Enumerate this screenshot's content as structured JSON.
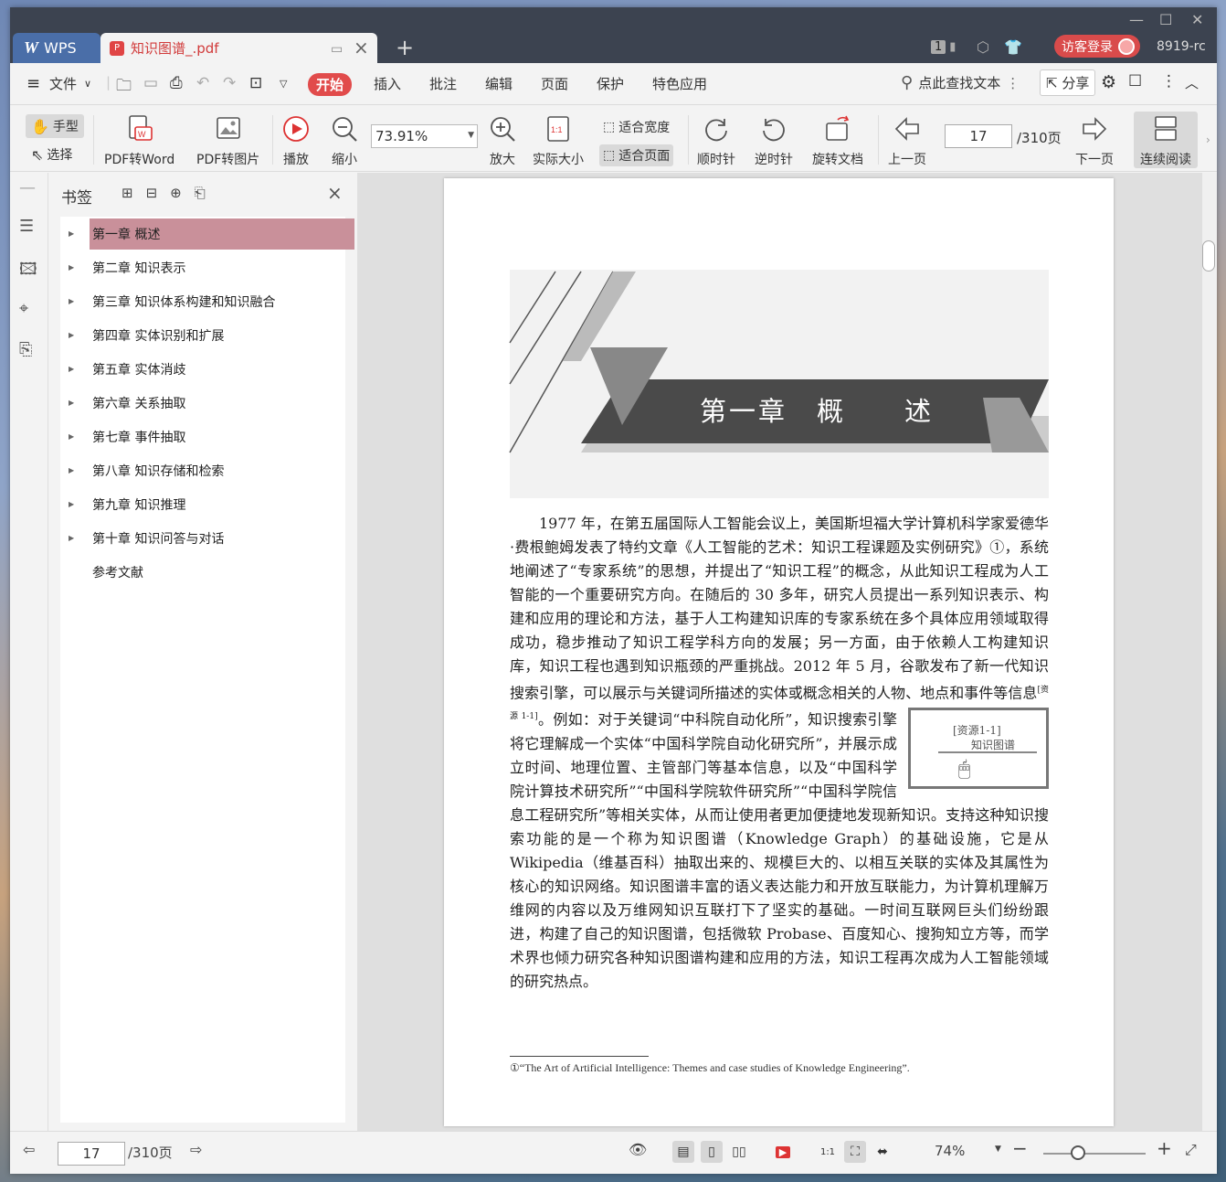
{
  "titlebar": {
    "app_tab": "WPS",
    "doc_tab": "知识图谱_.pdf",
    "page_badge": "1",
    "login": "访客登录",
    "user": "8919-rc"
  },
  "menu": {
    "file": "文件",
    "items": [
      "开始",
      "插入",
      "批注",
      "编辑",
      "页面",
      "保护",
      "特色应用"
    ],
    "search": "点此查找文本",
    "share": "分享"
  },
  "ribbon": {
    "hand": "手型",
    "select": "选择",
    "pdf_to_word": "PDF转Word",
    "pdf_to_image": "PDF转图片",
    "play": "播放",
    "zoom_out": "缩小",
    "zoom_value": "73.91%",
    "zoom_in": "放大",
    "actual_size": "实际大小",
    "fit_width": "适合宽度",
    "fit_page": "适合页面",
    "clockwise": "顺时针",
    "counterclockwise": "逆时针",
    "rotate_doc": "旋转文档",
    "prev_page": "上一页",
    "page_current": "17",
    "page_total": "/310页",
    "next_page": "下一页",
    "continuous": "连续阅读"
  },
  "bookmarks": {
    "title": "书签",
    "items": [
      {
        "label": "第一章 概述",
        "selected": true,
        "expandable": true
      },
      {
        "label": "第二章 知识表示",
        "expandable": true
      },
      {
        "label": "第三章 知识体系构建和知识融合",
        "expandable": true
      },
      {
        "label": "第四章 实体识别和扩展",
        "expandable": true
      },
      {
        "label": "第五章 实体消歧",
        "expandable": true
      },
      {
        "label": "第六章 关系抽取",
        "expandable": true
      },
      {
        "label": "第七章 事件抽取",
        "expandable": true
      },
      {
        "label": "第八章 知识存储和检索",
        "expandable": true
      },
      {
        "label": "第九章 知识推理",
        "expandable": true
      },
      {
        "label": "第十章 知识问答与对话",
        "expandable": true
      },
      {
        "label": "参考文献",
        "expandable": false
      }
    ]
  },
  "document": {
    "chapter_title": "第一章　概　　述",
    "para_before_box": "1977 年，在第五届国际人工智能会议上，美国斯坦福大学计算机科学家爱德华·费根鲍姆发表了特约文章《人工智能的艺术：知识工程课题及实例研究》①，系统地阐述了“专家系统”的思想，并提出了“知识工程”的概念，从此知识工程成为人工智能的一个重要研究方向。在随后的 30 多年，研究人员提出一系列知识表示、构建和应用的理论和方法，基于人工构建知识库的专家系统在多个具体应用领域取得成功，稳步推动了知识工程学科方向的发展；另一方面，由于依赖人工构建知识库，知识工程也遇到知识瓶颈的严重挑战。2012 年 5 月，谷歌发布了新一代知识搜索引擎，可以展示与关键词所描述的实体或概念相关的人物、地点和事件等信息",
    "resource_ref": "[资源 1-1]",
    "para_after_box": "。例如：对于关键词“中科院自动化所”，知识搜索引擎将它理解成一个实体“中国科学院自动化研究所”，并展示成立时间、地理位置、主管部门等基本信息，以及“中国科学院计算技术研究所”“中国科学院软件研究所”“中国科学院信息工程研究所”等相关实体，从而让使用者更加便捷地发现新知识。支持这种知识搜索功能的是一个称为知识图谱（Knowledge Graph）的基础设施，它是从 Wikipedia（维基百科）抽取出来的、规模巨大的、以相互关联的实体及其属性为核心的知识网络。知识图谱丰富的语义表达能力和开放互联能力，为计算机理解万维网的内容以及万维网知识互联打下了坚实的基础。一时间互联网巨头们纷纷跟进，构建了自己的知识图谱，包括微软 Probase、百度知心、搜狗知立方等，而学术界也倾力研究各种知识图谱构建和应用的方法，知识工程再次成为人工智能领域的研究热点。",
    "resource_box_line1": "[资源1-1]",
    "resource_box_line2": "知识图谱",
    "footnote": "①“The Art of Artificial Intelligence: Themes and case studies of Knowledge Engineering”."
  },
  "status": {
    "page_current": "17",
    "page_total": "/310页",
    "zoom": "74%"
  },
  "colors": {
    "accent_red": "#e14b4b",
    "selected_bookmark": "#c9909a",
    "titlebar": "#3c4350"
  }
}
